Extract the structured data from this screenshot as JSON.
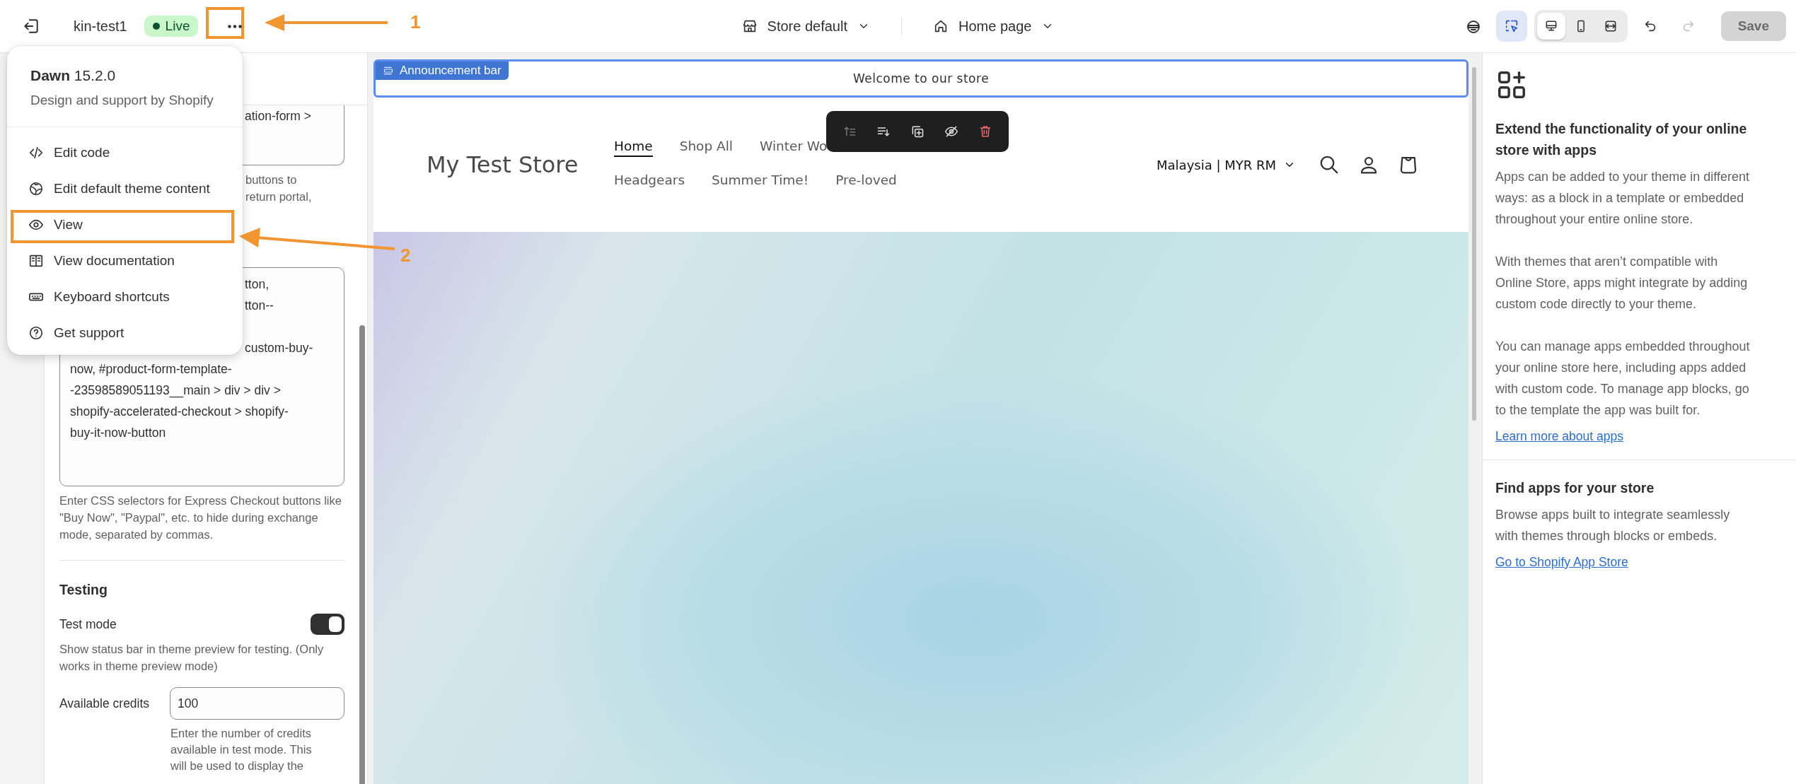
{
  "top_bar": {
    "theme_name": "kin-test1",
    "status": "Live",
    "store_selector": "Store default",
    "page_selector": "Home page",
    "inspector": {
      "selected": true
    },
    "view_modes": [
      {
        "kind": "desktop",
        "selected": true
      },
      {
        "kind": "mobile",
        "selected": false
      },
      {
        "kind": "fullwidth",
        "selected": false
      }
    ],
    "undo": {
      "disabled": false
    },
    "redo": {
      "disabled": true
    },
    "save": {
      "label": "Save",
      "disabled": true
    }
  },
  "theme_menu": {
    "name": "Dawn",
    "version": "15.2.0",
    "subtitle": "Design and support by Shopify",
    "items": [
      {
        "label": "Edit code"
      },
      {
        "label": "Edit default theme content"
      },
      {
        "label": "View"
      },
      {
        "label": "View documentation"
      },
      {
        "label": "Keyboard shortcuts"
      },
      {
        "label": "Get support"
      }
    ]
  },
  "settings_panel": {
    "field_1_fragment": "ation-form >",
    "help_1_fragment": "buttons to\nreturn portal,",
    "field_2_fragment": "tton,\ntton--\n\ncustom-buy-",
    "field_2_text": "now, #product-form-template-\n-23598589051193__main > div > div >\nshopify-accelerated-checkout > shopify-\nbuy-it-now-button",
    "field_2_help": "Enter CSS selectors for Express Checkout buttons like \"Buy Now\", \"Paypal\", etc. to hide during exchange mode, separated by commas.",
    "section_title": "Testing",
    "test_mode": {
      "label": "Test mode",
      "on": true,
      "help": "Show status bar in theme preview for testing. (Only works in theme preview mode)"
    },
    "credits": {
      "label": "Available credits",
      "value": "100",
      "help": "Enter the number of credits available in test mode. This will be used to display the"
    }
  },
  "preview": {
    "section_tag": "Announcement bar",
    "announcement": "Welcome to our store",
    "logo": "My Test Store",
    "nav_rows": [
      [
        {
          "label": "Home",
          "selected": true
        },
        {
          "label": "Shop All",
          "selected": false
        },
        {
          "label": "Winter Wo",
          "selected": false
        }
      ],
      [
        {
          "label": "Headgears",
          "selected": false
        },
        {
          "label": "Summer Time!",
          "selected": false
        },
        {
          "label": "Pre-loved",
          "selected": false
        }
      ]
    ],
    "localization": "Malaysia | MYR RM",
    "block_toolbar": [
      {
        "kind": "move_up",
        "disabled": true
      },
      {
        "kind": "move_down",
        "disabled": false
      },
      {
        "kind": "duplicate",
        "disabled": false
      },
      {
        "kind": "hide",
        "disabled": false
      },
      {
        "kind": "delete",
        "disabled": false
      }
    ]
  },
  "apps_panel": {
    "title": "Extend the functionality of your online store with apps",
    "paragraphs": [
      "Apps can be added to your theme in different ways: as a block in a template or embedded throughout your entire online store.",
      "With themes that aren’t compatible with Online Store, apps might integrate by adding custom code directly to your theme.",
      "You can manage apps embedded throughout your online store here, including apps added with custom code. To manage app blocks, go to the template the app was built for."
    ],
    "link": "Learn more about apps",
    "find_title": "Find apps for your store",
    "find_text": "Browse apps built to integrate seamlessly with themes through blocks or embeds.",
    "find_link": "Go to Shopify App Store"
  },
  "annotations": [
    {
      "kind": "menu_button",
      "label": "1"
    },
    {
      "kind": "view_item",
      "label": "2"
    }
  ]
}
